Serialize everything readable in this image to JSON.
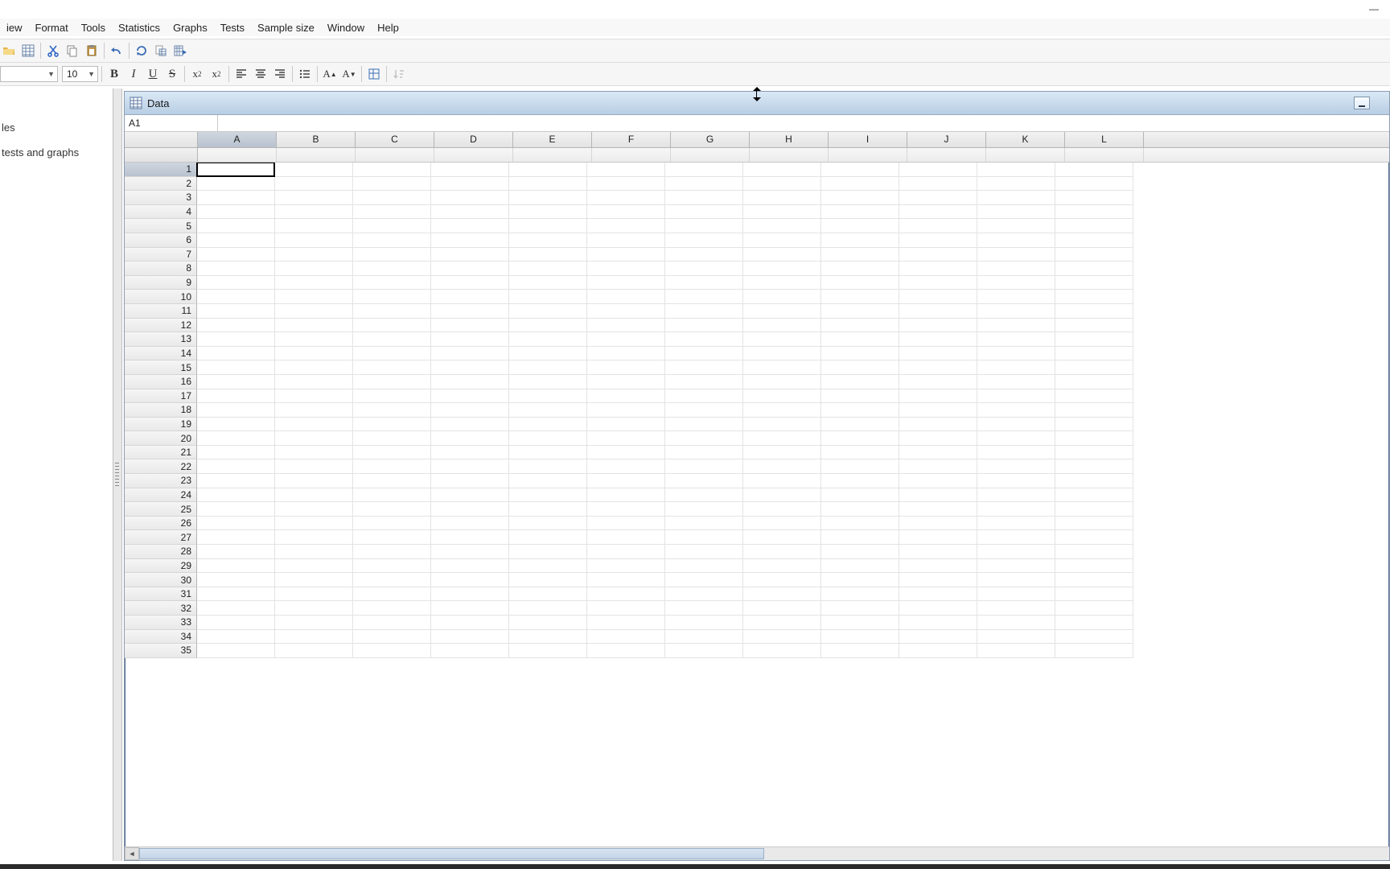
{
  "menu": {
    "items": [
      "iew",
      "Format",
      "Tools",
      "Statistics",
      "Graphs",
      "Tests",
      "Sample size",
      "Window",
      "Help"
    ]
  },
  "toolbar2": {
    "font_name": "",
    "font_size": "10"
  },
  "side": {
    "item1": "les",
    "item2": "tests and graphs"
  },
  "data_window": {
    "title": "Data",
    "cell_ref": "A1"
  },
  "columns": [
    "A",
    "B",
    "C",
    "D",
    "E",
    "F",
    "G",
    "H",
    "I",
    "J",
    "K",
    "L"
  ],
  "rows": [
    "1",
    "2",
    "3",
    "4",
    "5",
    "6",
    "7",
    "8",
    "9",
    "10",
    "11",
    "12",
    "13",
    "14",
    "15",
    "16",
    "17",
    "18",
    "19",
    "20",
    "21",
    "22",
    "23",
    "24",
    "25",
    "26",
    "27",
    "28",
    "29",
    "30",
    "31",
    "32",
    "33",
    "34",
    "35"
  ],
  "selected_col_index": 0,
  "selected_row_index": 0
}
